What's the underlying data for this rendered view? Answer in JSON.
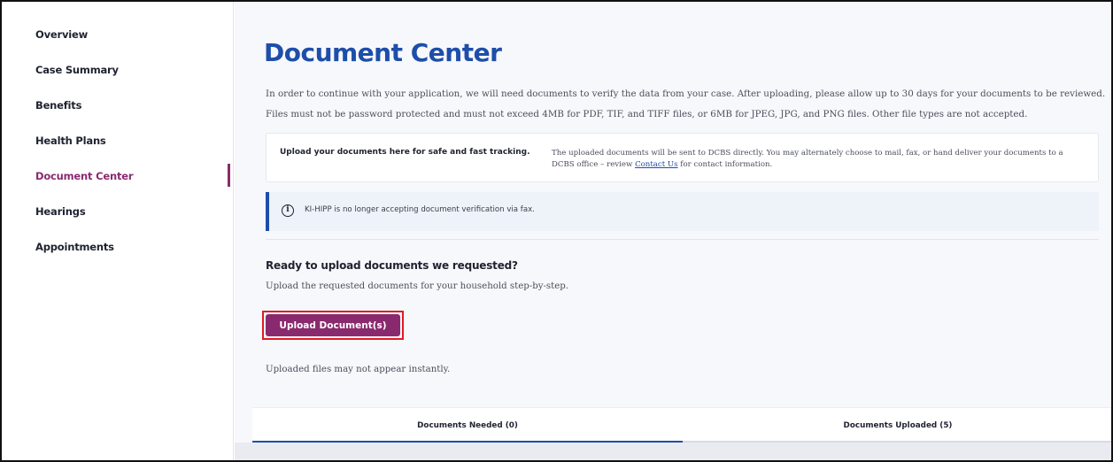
{
  "sidebar": {
    "items": [
      {
        "label": "Overview",
        "active": false
      },
      {
        "label": "Case Summary",
        "active": false
      },
      {
        "label": "Benefits",
        "active": false
      },
      {
        "label": "Health Plans",
        "active": false
      },
      {
        "label": "Document Center",
        "active": true
      },
      {
        "label": "Hearings",
        "active": false
      },
      {
        "label": "Appointments",
        "active": false
      }
    ]
  },
  "main": {
    "title": "Document Center",
    "intro_line1": "In order to continue with your application, we will need documents to verify the data from your case. After uploading, please allow up to 30 days for your documents to be reviewed.",
    "intro_line2": "Files must not be password protected and must not exceed 4MB for PDF, TIF, and TIFF files, or 6MB for JPEG, JPG, and PNG files. Other file types are not accepted.",
    "info_card": {
      "left": "Upload your documents here for safe and fast tracking.",
      "right_before": "The uploaded documents will be sent to DCBS directly. You may alternately choose to mail, fax, or hand deliver your documents to a DCBS office – review ",
      "link": "Contact Us",
      "right_after": " for contact information."
    },
    "alert": {
      "icon": "info-icon",
      "text": "KI-HIPP is no longer accepting document verification via fax."
    },
    "section": {
      "heading": "Ready to upload documents we requested?",
      "description": "Upload the requested documents for your household step-by-step.",
      "button": "Upload Document(s)",
      "note": "Uploaded files may not appear instantly."
    },
    "tabs": [
      {
        "label": "Documents Needed (0)",
        "active": true
      },
      {
        "label": "Documents Uploaded (5)",
        "active": false
      }
    ]
  },
  "colors": {
    "brand_blue": "#1d4eaa",
    "brand_purple": "#8a2a6e",
    "highlight_red": "#e01b24"
  }
}
